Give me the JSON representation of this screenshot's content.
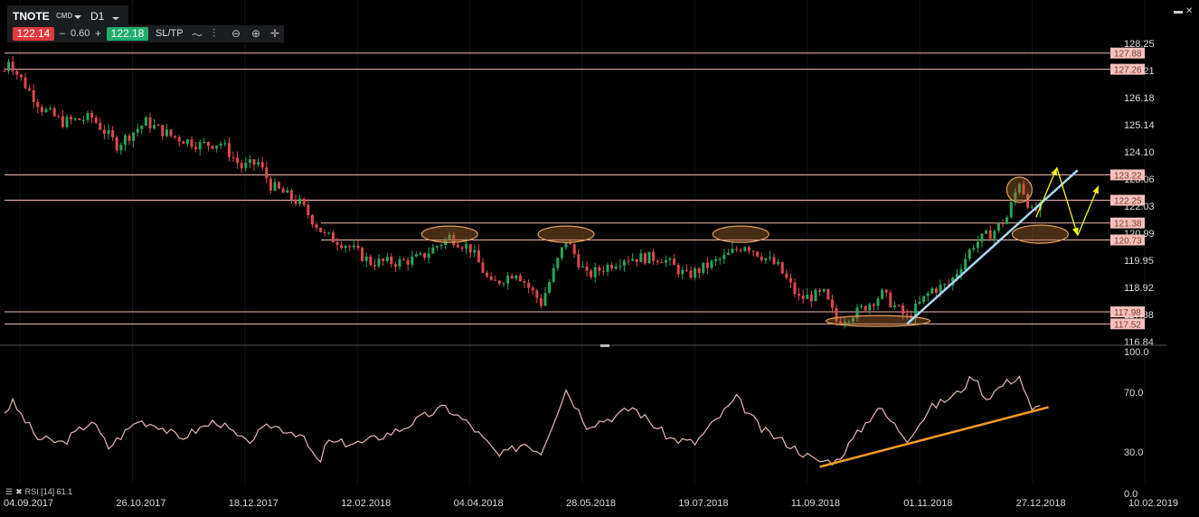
{
  "toolbar": {
    "symbol": "TNOTE",
    "symbol_type": "CMD",
    "timeframe": "D1",
    "bid": "122.14",
    "minus": "–",
    "spread": "0.60",
    "plus": "+",
    "ask": "122.18",
    "sltp_label": "SL/TP",
    "icons": [
      "line-chart-icon",
      "indicators-icon",
      "zoom-out-icon",
      "zoom-in-icon",
      "crosshair-icon"
    ]
  },
  "window": {
    "icons": [
      "minimize-icon",
      "close-icon"
    ]
  },
  "indicator": {
    "label": "RSI [14] 61.1",
    "icons": [
      "menu-icon",
      "remove-icon"
    ]
  },
  "colors": {
    "up": "#26a65b",
    "down": "#e0474c",
    "level": "#f2b8b0",
    "level_label_bg": "#f6c1bd",
    "rsi": "#e8b9b4",
    "trend_price": "#a9d8f0",
    "trend_rsi": "#f59a23",
    "arrows": "#f5f51e",
    "ellipse": "#e0a060"
  },
  "chart_data": [
    {
      "type": "candlestick",
      "title": "TNOTE D1",
      "ylim": [
        116.84,
        128.25
      ],
      "y_ticks": [
        "128.25",
        "127.21",
        "126.18",
        "125.14",
        "124.10",
        "123.06",
        "122.03",
        "120.99",
        "119.95",
        "118.92",
        "117.88",
        "116.84"
      ],
      "x_ticks": [
        "04.09.2017",
        "26.10.2017",
        "18.12.2017",
        "12.02.2018",
        "04.04.2018",
        "28.05.2018",
        "19.07.2018",
        "11.09.2018",
        "01.11.2018",
        "27.12.2018",
        "10.02.2019"
      ],
      "price_path_day_close": [
        [
          0,
          127.2
        ],
        [
          1,
          127.66
        ],
        [
          3,
          127.1
        ],
        [
          9,
          125.76
        ],
        [
          14,
          125.24
        ],
        [
          21,
          125.41
        ],
        [
          27,
          124.37
        ],
        [
          34,
          125.24
        ],
        [
          40,
          124.72
        ],
        [
          47,
          124.37
        ],
        [
          52,
          124.44
        ],
        [
          57,
          123.51
        ],
        [
          61,
          123.68
        ],
        [
          64,
          122.82
        ],
        [
          71,
          122.13
        ],
        [
          77,
          120.9
        ],
        [
          82,
          120.57
        ],
        [
          88,
          119.88
        ],
        [
          95,
          119.88
        ],
        [
          100,
          120.05
        ],
        [
          107,
          120.85
        ],
        [
          112,
          120.4
        ],
        [
          117,
          119.0
        ],
        [
          123,
          119.53
        ],
        [
          129,
          118.32
        ],
        [
          135,
          120.74
        ],
        [
          140,
          119.35
        ],
        [
          149,
          120.05
        ],
        [
          158,
          120.05
        ],
        [
          164,
          119.35
        ],
        [
          173,
          120.05
        ],
        [
          178,
          120.57
        ],
        [
          186,
          119.7
        ],
        [
          191,
          118.49
        ],
        [
          197,
          118.66
        ],
        [
          200,
          117.63
        ],
        [
          205,
          117.97
        ],
        [
          211,
          118.66
        ],
        [
          217,
          117.73
        ],
        [
          223,
          118.84
        ],
        [
          227,
          119.0
        ],
        [
          233,
          120.57
        ],
        [
          238,
          121.09
        ],
        [
          241,
          121.6
        ],
        [
          244,
          122.99
        ],
        [
          247,
          121.78
        ],
        [
          249,
          121.95
        ]
      ],
      "levels": [
        "127.88",
        "127.26",
        "123.22",
        "122.25",
        "121.38",
        "120.73",
        "117.98",
        "117.52"
      ],
      "trendline": [
        [
          217,
          117.52
        ],
        [
          258,
          123.4
        ]
      ],
      "arrow_path": [
        [
          248,
          121.6
        ],
        [
          253,
          123.5
        ],
        [
          258,
          120.9
        ],
        [
          263,
          122.8
        ]
      ],
      "ellipses": [
        [
          107,
          120.95
        ],
        [
          135,
          120.95
        ],
        [
          177,
          120.95
        ],
        [
          210,
          117.63
        ],
        [
          244,
          122.65
        ],
        [
          249,
          120.95
        ]
      ]
    },
    {
      "type": "line",
      "title": "RSI [14]",
      "ylim": [
        0,
        100
      ],
      "y_ticks": [
        "100.0",
        "70.0",
        "30.0",
        "0.0"
      ],
      "last_value": 61.1,
      "path": [
        [
          0,
          57
        ],
        [
          2,
          63
        ],
        [
          8,
          39
        ],
        [
          14,
          36
        ],
        [
          21,
          51
        ],
        [
          25,
          33
        ],
        [
          32,
          51
        ],
        [
          37,
          48
        ],
        [
          42,
          39
        ],
        [
          51,
          51
        ],
        [
          58,
          36
        ],
        [
          64,
          48
        ],
        [
          71,
          42
        ],
        [
          76,
          21
        ],
        [
          77,
          36
        ],
        [
          86,
          36
        ],
        [
          95,
          45
        ],
        [
          101,
          54
        ],
        [
          106,
          60
        ],
        [
          112,
          48
        ],
        [
          119,
          27
        ],
        [
          125,
          36
        ],
        [
          129,
          30
        ],
        [
          135,
          72
        ],
        [
          140,
          48
        ],
        [
          147,
          54
        ],
        [
          151,
          60
        ],
        [
          160,
          39
        ],
        [
          166,
          36
        ],
        [
          173,
          57
        ],
        [
          176,
          66
        ],
        [
          182,
          45
        ],
        [
          188,
          36
        ],
        [
          195,
          24
        ],
        [
          200,
          24
        ],
        [
          205,
          42
        ],
        [
          210,
          60
        ],
        [
          217,
          39
        ],
        [
          223,
          60
        ],
        [
          229,
          69
        ],
        [
          233,
          81
        ],
        [
          236,
          66
        ],
        [
          240,
          75
        ],
        [
          244,
          81
        ],
        [
          247,
          57
        ],
        [
          249,
          61.1
        ]
      ],
      "trendline": [
        [
          196,
          20
        ],
        [
          251,
          60
        ]
      ]
    }
  ]
}
